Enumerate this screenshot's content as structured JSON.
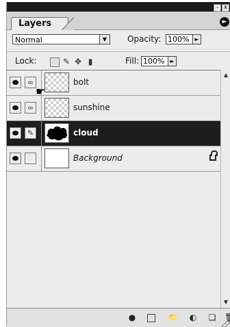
{
  "panel": {
    "tab_label": "Layers",
    "menu_icon": "circle-arrow-right-icon",
    "close_glyph": "x",
    "minimize_glyph": "-"
  },
  "options": {
    "blend_mode": "Normal",
    "opacity_label": "Opacity:",
    "opacity_value": "100%",
    "lock_label": "Lock:",
    "fill_label": "Fill:",
    "fill_value": "100%",
    "lock_icons": [
      "lock-transparent-icon",
      "lock-image-icon",
      "lock-position-icon",
      "lock-all-icon"
    ]
  },
  "layers": [
    {
      "name": "bolt",
      "visible": true,
      "linked": true,
      "selected": false,
      "thumbnail": "transparent"
    },
    {
      "name": "sunshine",
      "visible": true,
      "linked": true,
      "selected": false,
      "thumbnail": "transparent"
    },
    {
      "name": "cloud",
      "visible": true,
      "linked": false,
      "brush": true,
      "selected": true,
      "thumbnail": "black-cloud"
    },
    {
      "name": "Background",
      "visible": true,
      "linked": false,
      "selected": false,
      "thumbnail": "white",
      "locked": true
    }
  ],
  "bottom_icons": [
    "add-layer-style-icon",
    "add-mask-icon",
    "new-set-icon",
    "new-adjustment-layer-icon",
    "new-layer-icon",
    "trash-icon"
  ]
}
